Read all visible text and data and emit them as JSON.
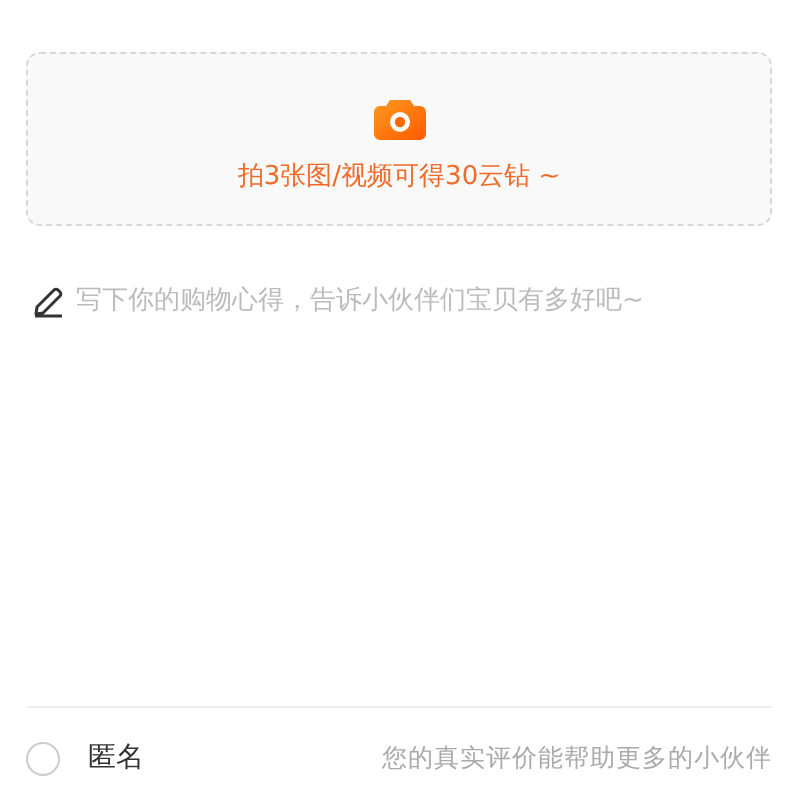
{
  "upload": {
    "label": "拍3张图/视频可得30云钻 ~"
  },
  "review": {
    "placeholder": "写下你的购物心得，告诉小伙伴们宝贝有多好吧~"
  },
  "anonymous": {
    "label": "匿名",
    "checked": false,
    "hint": "您的真实评价能帮助更多的小伙伴"
  }
}
